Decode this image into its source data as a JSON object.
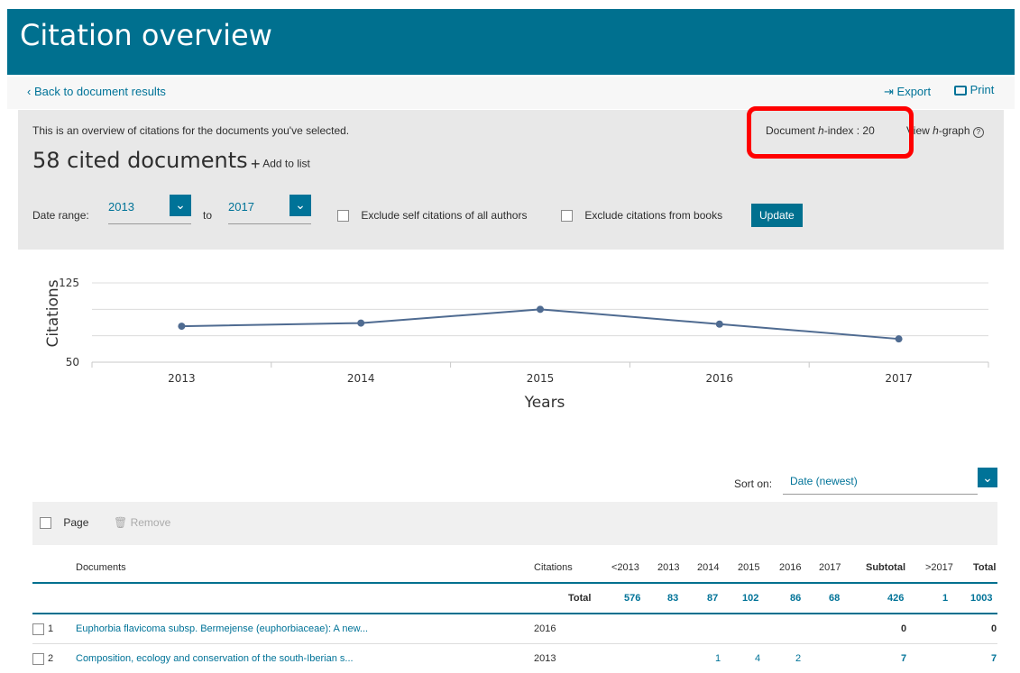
{
  "header": {
    "title": "Citation overview"
  },
  "toolbar": {
    "back_label": "Back to document results",
    "export_label": "Export",
    "print_label": "Print"
  },
  "panel": {
    "intro": "This is an overview of citations for the documents you've selected.",
    "hindex_label": "Document",
    "hindex_h": "h",
    "hindex_rest": "-index : 20",
    "view_label": "View",
    "graph_h": "h",
    "graph_rest": "-graph",
    "count_title": "58 cited documents",
    "add_to_list": "Add to list",
    "date_range_label": "Date range:",
    "date_from": "2013",
    "to_label": "to",
    "date_to": "2017",
    "exclude_self": "Exclude self citations of all authors",
    "exclude_books": "Exclude citations from books",
    "update_label": "Update"
  },
  "chart_data": {
    "type": "line",
    "x": [
      "2013",
      "2014",
      "2015",
      "2016",
      "2017"
    ],
    "series": [
      {
        "values": [
          84,
          87,
          100,
          86,
          72
        ]
      }
    ],
    "ylim": [
      50,
      125
    ],
    "yticks": [
      "125",
      "50"
    ],
    "ylabel": "Citations",
    "xlabel": "Years",
    "color": "#4f6b91"
  },
  "sort": {
    "label": "Sort on:",
    "value": "Date (newest)"
  },
  "bulk": {
    "page_label": "Page",
    "remove_label": "Remove"
  },
  "table": {
    "headers": [
      "Documents",
      "Citations",
      "<2013",
      "2013",
      "2014",
      "2015",
      "2016",
      "2017",
      "Subtotal",
      ">2017",
      "Total"
    ],
    "total_row": {
      "label": "Total",
      "values": [
        "576",
        "83",
        "87",
        "102",
        "86",
        "68",
        "426",
        "1",
        "1003"
      ]
    },
    "rows": [
      {
        "index": "1",
        "title": "Euphorbia flavicoma subsp. Bermejense (euphorbiaceae): A new...",
        "year": "2016",
        "values": [
          "",
          "",
          "",
          "",
          "",
          "",
          "0",
          "",
          "0"
        ]
      },
      {
        "index": "2",
        "title": "Composition, ecology and conservation of the south-Iberian s...",
        "year": "2013",
        "values": [
          "",
          "",
          "1",
          "4",
          "2",
          "",
          "7",
          "",
          "7"
        ]
      }
    ]
  }
}
